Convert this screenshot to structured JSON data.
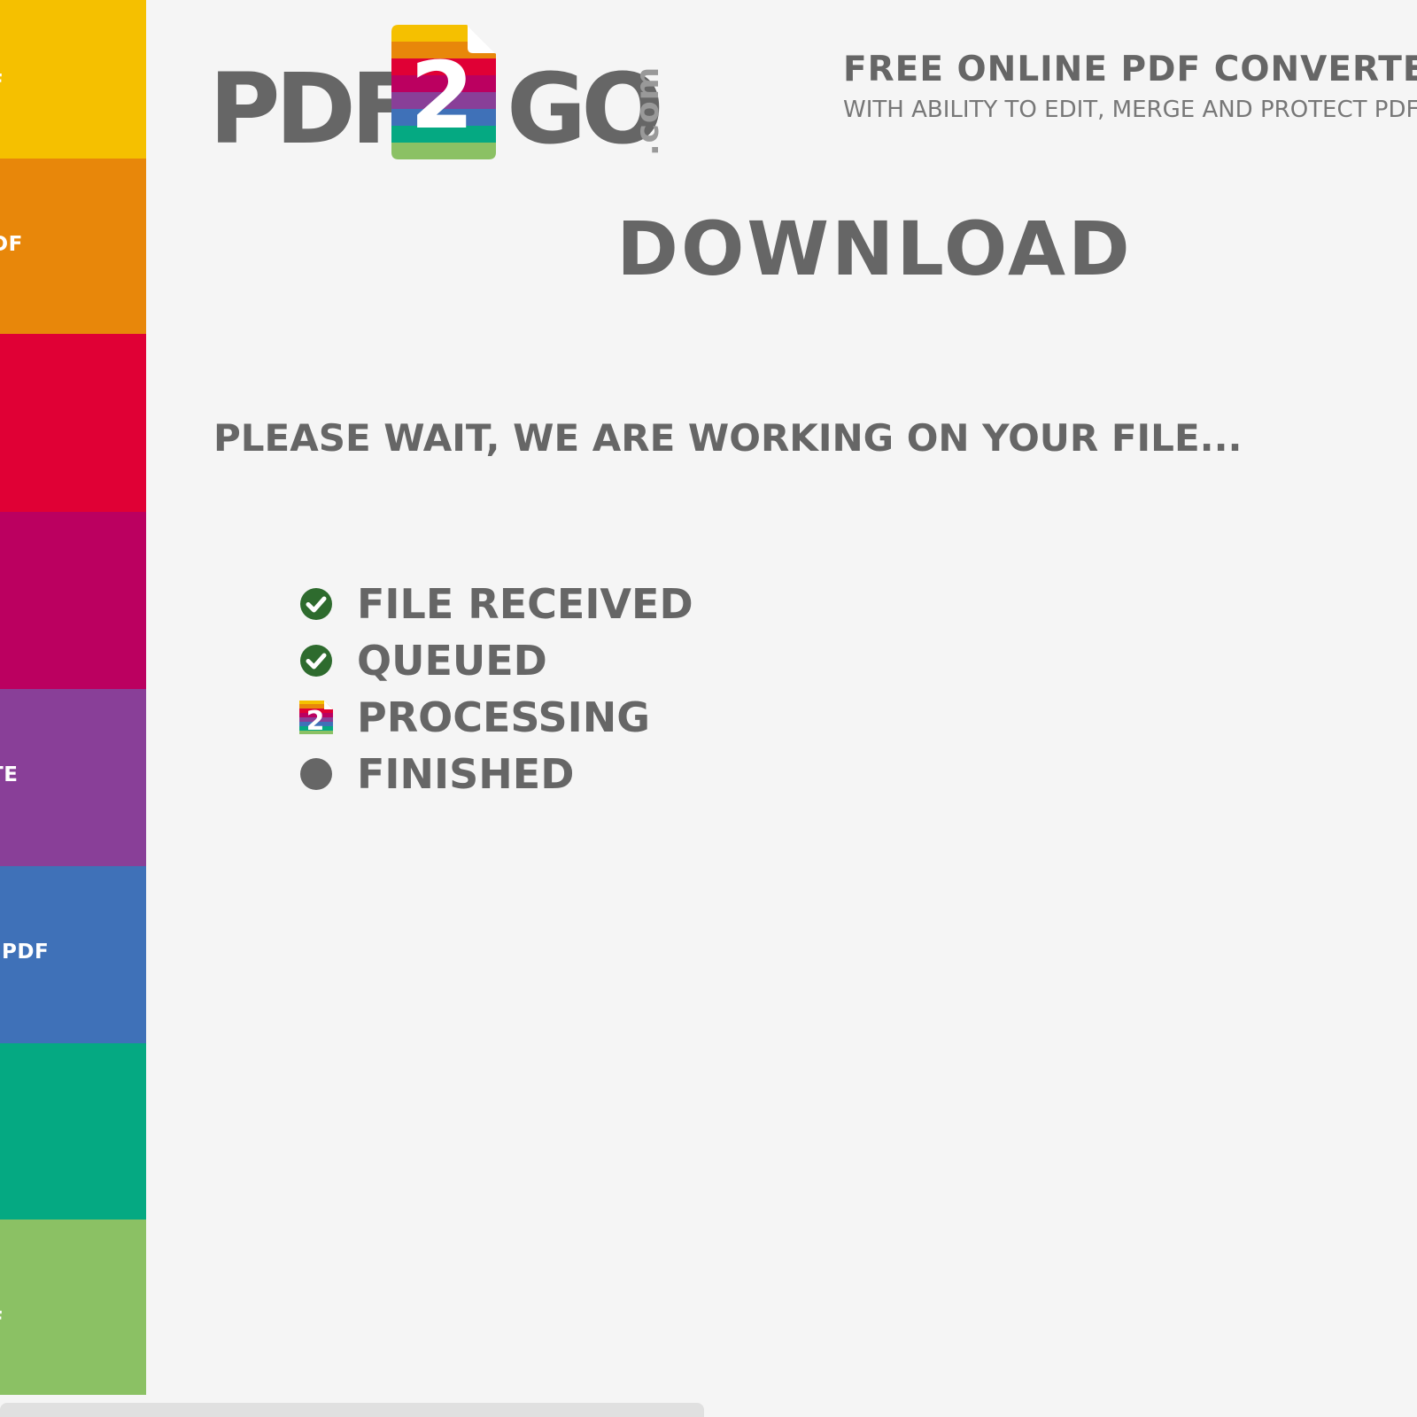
{
  "colors": {
    "background": "#f5f5f5",
    "text": "#666666",
    "success": "#2e6b2e",
    "neutral": "#666666",
    "logo_stripes": [
      "#f5c000",
      "#e8870a",
      "#e00035",
      "#bb0060",
      "#893f98",
      "#3f71b8",
      "#05a982",
      "#8bc164"
    ]
  },
  "sidebar": {
    "items": [
      {
        "label": "F",
        "color": "#f5c000"
      },
      {
        "label": "DF",
        "color": "#e8870a"
      },
      {
        "label": "",
        "color": "#e00035"
      },
      {
        "label": "",
        "color": "#bb0060"
      },
      {
        "label": "TE",
        "color": "#893f98"
      },
      {
        "label": "PDF",
        "color": "#3f71b8"
      },
      {
        "label": "",
        "color": "#05a982"
      },
      {
        "label": "F",
        "color": "#8bc164"
      }
    ]
  },
  "header": {
    "logo": {
      "part1": "PDF",
      "digit": "2",
      "part2": "GO",
      "suffix": ".com"
    },
    "tagline": "FREE ONLINE PDF CONVERTER",
    "subtagline": "WITH ABILITY TO EDIT, MERGE AND PROTECT PDF"
  },
  "main": {
    "title": "DOWNLOAD",
    "status_message": "PLEASE WAIT, WE ARE WORKING ON YOUR FILE...",
    "steps": [
      {
        "label": "FILE RECEIVED",
        "state": "done",
        "icon": "check-circle-icon"
      },
      {
        "label": "QUEUED",
        "state": "done",
        "icon": "check-circle-icon"
      },
      {
        "label": "PROCESSING",
        "state": "active",
        "icon": "pdf2go-spinner-icon"
      },
      {
        "label": "FINISHED",
        "state": "pending",
        "icon": "dot-icon"
      }
    ]
  }
}
